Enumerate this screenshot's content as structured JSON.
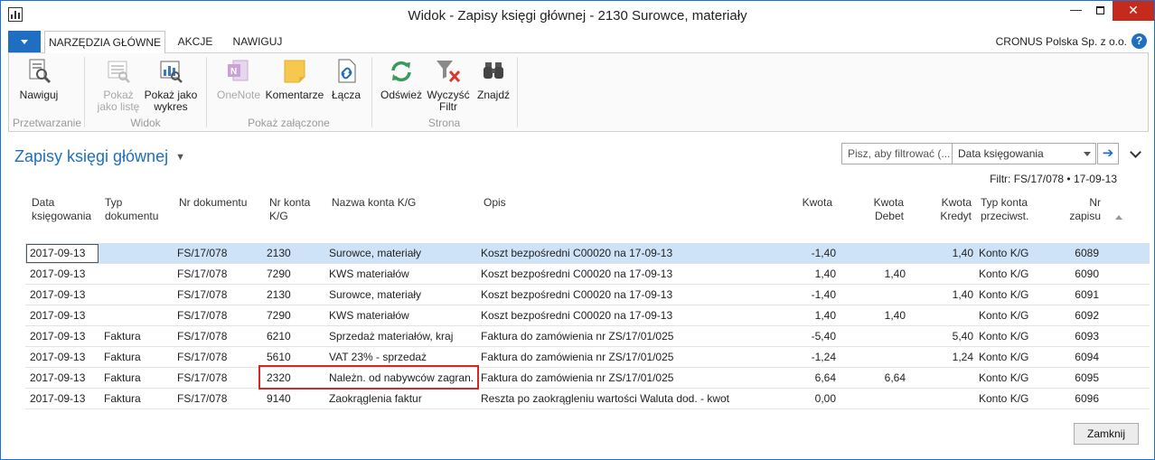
{
  "window": {
    "title": "Widok - Zapisy księgi głównej - 2130 Surowce, materiały",
    "minimize": "—",
    "close": "✕"
  },
  "ribbon_tabs": [
    "NARZĘDZIA GŁÓWNE",
    "AKCJE",
    "NAWIGUJ"
  ],
  "company": "CRONUS Polska Sp. z o.o.",
  "help": "?",
  "ribbon": {
    "buttons": [
      {
        "label": "Nawiguj",
        "icon": "navigate-icon",
        "enabled": true
      },
      {
        "label": "Pokaż jako listę",
        "icon": "list-view-icon",
        "enabled": false
      },
      {
        "label": "Pokaż jako wykres",
        "icon": "chart-view-icon",
        "enabled": true
      },
      {
        "label": "OneNote",
        "icon": "onenote-icon",
        "enabled": false
      },
      {
        "label": "Komentarze",
        "icon": "comments-icon",
        "enabled": true
      },
      {
        "label": "Łącza",
        "icon": "links-icon",
        "enabled": true
      },
      {
        "label": "Odśwież",
        "icon": "refresh-icon",
        "enabled": true
      },
      {
        "label": "Wyczyść Filtr",
        "icon": "clear-filter-icon",
        "enabled": true
      },
      {
        "label": "Znajdź",
        "icon": "find-icon",
        "enabled": true
      }
    ],
    "groups": [
      "Przetwarzanie",
      "Widok",
      "Pokaż załączone",
      "Strona"
    ]
  },
  "page": {
    "title": "Zapisy księgi głównej",
    "search_placeholder": "Pisz, aby filtrować (...",
    "filter_field": "Data księgowania",
    "filter_text": "Filtr: FS/17/078 • 17-09-13"
  },
  "table": {
    "columns": [
      "Data księgowania",
      "Typ dokumentu",
      "Nr dokumentu",
      "Nr konta K/G",
      "Nazwa konta K/G",
      "Opis",
      "Kwota",
      "Kwota Debet",
      "Kwota Kredyt",
      "Typ konta przeciwst.",
      "Nr zapisu"
    ],
    "column_headers_display": [
      [
        "Data",
        "księgowania"
      ],
      [
        "Typ",
        "dokumentu"
      ],
      [
        "Nr dokumentu",
        ""
      ],
      [
        "Nr konta",
        "K/G"
      ],
      [
        "Nazwa konta K/G",
        ""
      ],
      [
        "Opis",
        ""
      ],
      [
        "Kwota",
        ""
      ],
      [
        "Kwota",
        "Debet"
      ],
      [
        "Kwota",
        "Kredyt"
      ],
      [
        "Typ konta",
        "przeciwst."
      ],
      [
        "Nr",
        "zapisu"
      ]
    ],
    "sorted_column": "Nr zapisu",
    "sort_direction": "ascending",
    "rows": [
      [
        "2017-09-13",
        "",
        "FS/17/078",
        "2130",
        "Surowce, materiały",
        "Koszt bezpośredni C00020 na 17-09-13",
        "-1,40",
        "",
        "1,40",
        "Konto K/G",
        "6089"
      ],
      [
        "2017-09-13",
        "",
        "FS/17/078",
        "7290",
        "KWS materiałów",
        "Koszt bezpośredni C00020 na 17-09-13",
        "1,40",
        "1,40",
        "",
        "Konto K/G",
        "6090"
      ],
      [
        "2017-09-13",
        "",
        "FS/17/078",
        "2130",
        "Surowce, materiały",
        "Koszt bezpośredni C00020 na 17-09-13",
        "-1,40",
        "",
        "1,40",
        "Konto K/G",
        "6091"
      ],
      [
        "2017-09-13",
        "",
        "FS/17/078",
        "7290",
        "KWS materiałów",
        "Koszt bezpośredni C00020 na 17-09-13",
        "1,40",
        "1,40",
        "",
        "Konto K/G",
        "6092"
      ],
      [
        "2017-09-13",
        "Faktura",
        "FS/17/078",
        "6210",
        "Sprzedaż materiałów, kraj",
        "Faktura do zamówienia nr ZS/17/01/025",
        "-5,40",
        "",
        "5,40",
        "Konto K/G",
        "6093"
      ],
      [
        "2017-09-13",
        "Faktura",
        "FS/17/078",
        "5610",
        "VAT 23% - sprzedaż",
        "Faktura do zamówienia nr ZS/17/01/025",
        "-1,24",
        "",
        "1,24",
        "Konto K/G",
        "6094"
      ],
      [
        "2017-09-13",
        "Faktura",
        "FS/17/078",
        "2320",
        "Należn. od nabywców zagran.",
        "Faktura do zamówienia nr ZS/17/01/025",
        "6,64",
        "6,64",
        "",
        "Konto K/G",
        "6095"
      ],
      [
        "2017-09-13",
        "Faktura",
        "FS/17/078",
        "9140",
        "Zaokrąglenia faktur",
        "Reszta po zaokrągleniu wartości Waluta dod. - kwot",
        "0,00",
        "",
        "",
        "Konto K/G",
        "6096"
      ]
    ],
    "selected_row": 0,
    "highlighted_row": 6
  },
  "close_button": "Zamknij",
  "colors": {
    "accent": "#1e6fc2",
    "selected_row": "#cfe3f8",
    "highlight": "#d62828",
    "close_button": "#c42b1c"
  }
}
